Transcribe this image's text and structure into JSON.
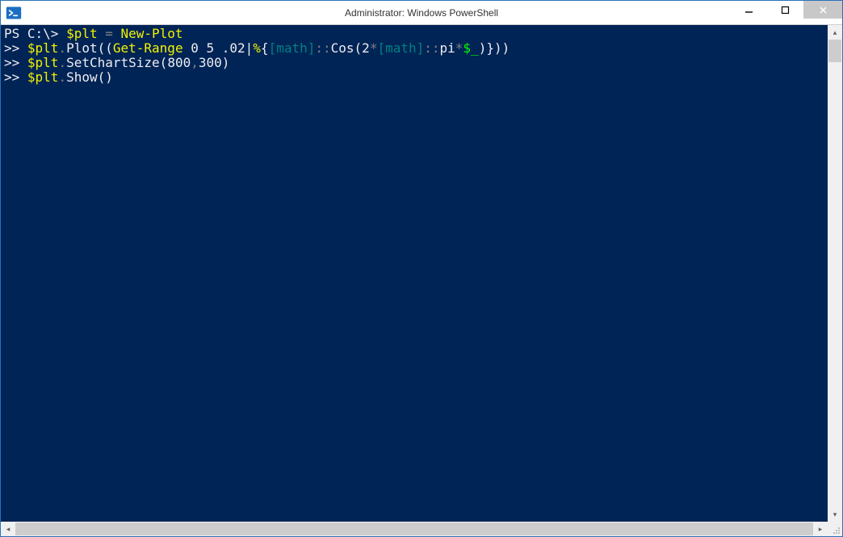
{
  "titlebar": {
    "title": "Administrator: Windows PowerShell"
  },
  "terminal": {
    "lines": [
      {
        "segments": [
          {
            "text": "PS C:\\> ",
            "cls": "c-white"
          },
          {
            "text": "$plt",
            "cls": "c-yellow"
          },
          {
            "text": " = ",
            "cls": "c-gray"
          },
          {
            "text": "New-Plot",
            "cls": "c-yellow"
          }
        ]
      },
      {
        "segments": [
          {
            "text": ">> ",
            "cls": "c-white"
          },
          {
            "text": "$plt",
            "cls": "c-yellow"
          },
          {
            "text": ".",
            "cls": "c-gray"
          },
          {
            "text": "Plot",
            "cls": "c-white"
          },
          {
            "text": "((",
            "cls": "c-white"
          },
          {
            "text": "Get-Range",
            "cls": "c-yellow"
          },
          {
            "text": " 0 5 .02",
            "cls": "c-white"
          },
          {
            "text": "|",
            "cls": "c-white"
          },
          {
            "text": "%",
            "cls": "c-yellow"
          },
          {
            "text": "{",
            "cls": "c-white"
          },
          {
            "text": "[math]",
            "cls": "c-teal"
          },
          {
            "text": "::",
            "cls": "c-gray"
          },
          {
            "text": "Cos",
            "cls": "c-white"
          },
          {
            "text": "(",
            "cls": "c-white"
          },
          {
            "text": "2",
            "cls": "c-white"
          },
          {
            "text": "*",
            "cls": "c-gray"
          },
          {
            "text": "[math]",
            "cls": "c-teal"
          },
          {
            "text": "::",
            "cls": "c-gray"
          },
          {
            "text": "pi",
            "cls": "c-white"
          },
          {
            "text": "*",
            "cls": "c-gray"
          },
          {
            "text": "$_",
            "cls": "c-green"
          },
          {
            "text": ")",
            "cls": "c-white"
          },
          {
            "text": "}",
            "cls": "c-white"
          },
          {
            "text": "))",
            "cls": "c-white"
          }
        ]
      },
      {
        "segments": [
          {
            "text": ">> ",
            "cls": "c-white"
          },
          {
            "text": "$plt",
            "cls": "c-yellow"
          },
          {
            "text": ".",
            "cls": "c-gray"
          },
          {
            "text": "SetChartSize",
            "cls": "c-white"
          },
          {
            "text": "(",
            "cls": "c-white"
          },
          {
            "text": "800",
            "cls": "c-white"
          },
          {
            "text": ",",
            "cls": "c-gray"
          },
          {
            "text": "300",
            "cls": "c-white"
          },
          {
            "text": ")",
            "cls": "c-white"
          }
        ]
      },
      {
        "segments": [
          {
            "text": ">> ",
            "cls": "c-white"
          },
          {
            "text": "$plt",
            "cls": "c-yellow"
          },
          {
            "text": ".",
            "cls": "c-gray"
          },
          {
            "text": "Show",
            "cls": "c-white"
          },
          {
            "text": "()",
            "cls": "c-white"
          }
        ]
      }
    ]
  }
}
